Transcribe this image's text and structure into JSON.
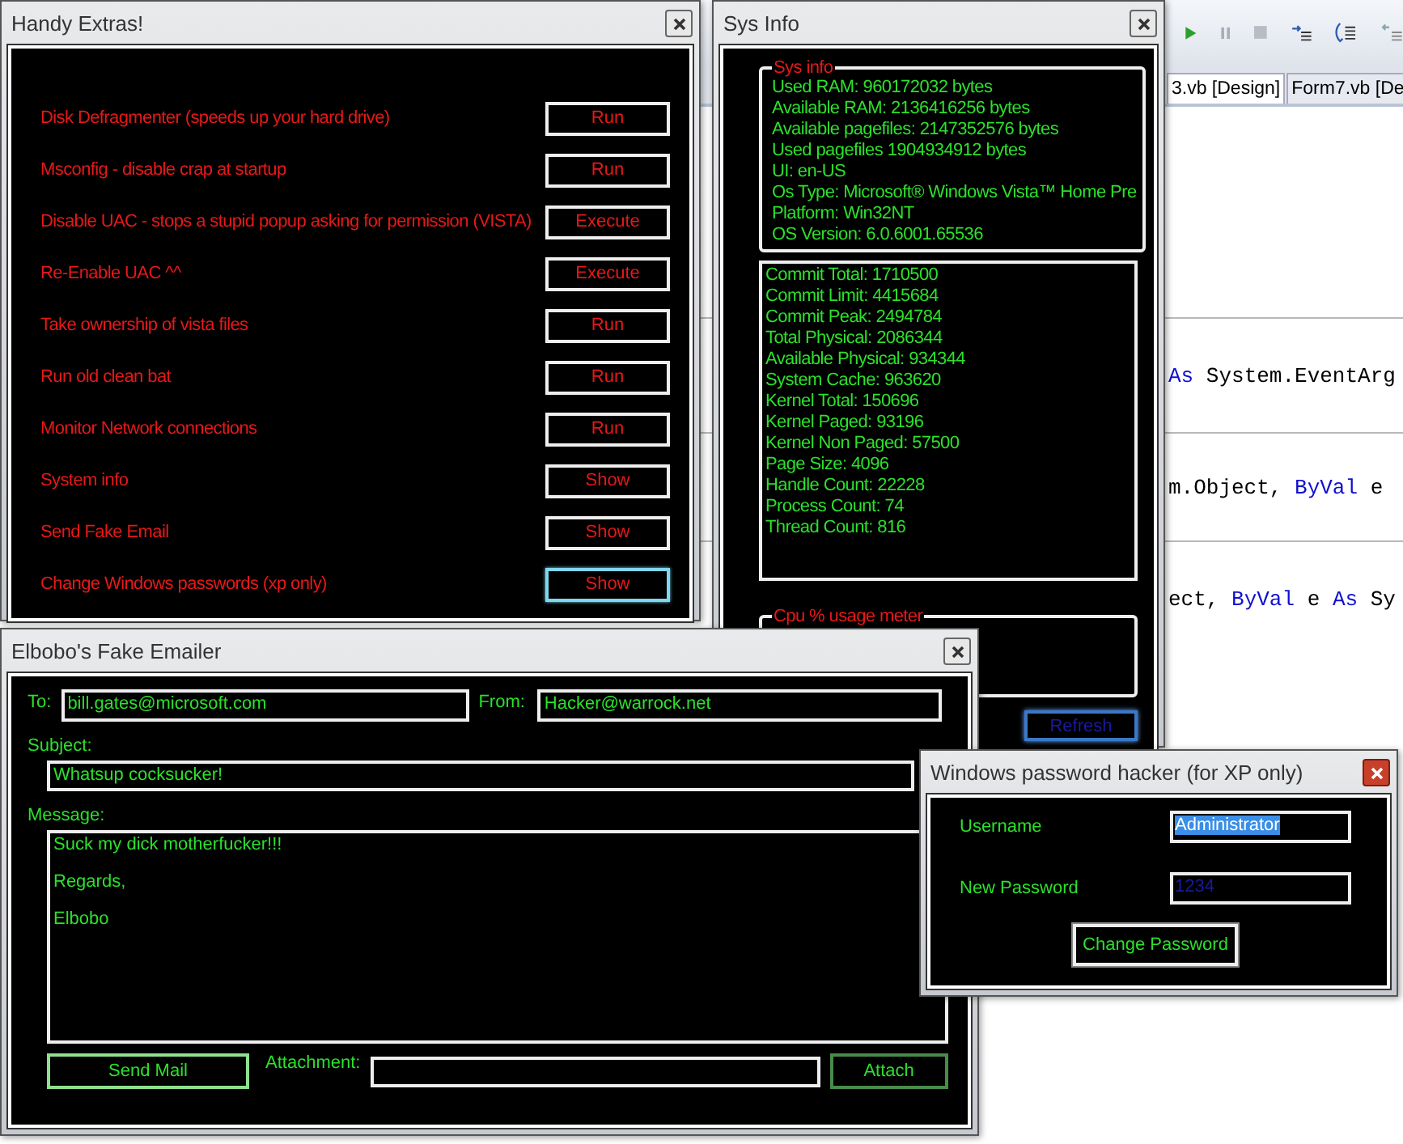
{
  "ide": {
    "tabs": [
      {
        "label": "3.vb [Design]",
        "selected": true
      },
      {
        "label": "Form7.vb [De",
        "selected": false
      }
    ],
    "code_lines": [
      [
        {
          "text": "As",
          "kind": "keyword"
        },
        {
          "text": " System.EventArg",
          "kind": "plain"
        }
      ],
      [
        {
          "text": "m.Object, ",
          "kind": "plain"
        },
        {
          "text": "ByVal",
          "kind": "keyword"
        },
        {
          "text": " e",
          "kind": "plain"
        }
      ],
      [
        {
          "text": "ect, ",
          "kind": "plain"
        },
        {
          "text": "ByVal",
          "kind": "keyword"
        },
        {
          "text": " e ",
          "kind": "plain"
        },
        {
          "text": "As",
          "kind": "keyword"
        },
        {
          "text": " Sy",
          "kind": "plain"
        }
      ]
    ]
  },
  "handy_extras": {
    "title": "Handy Extras!",
    "active": false,
    "items": [
      {
        "label": "Disk Defragmenter (speeds up your hard drive)",
        "button": "Run",
        "focused": false
      },
      {
        "label": "Msconfig - disable crap at startup",
        "button": "Run",
        "focused": false
      },
      {
        "label": "Disable UAC - stops a stupid popup asking for permission (VISTA)",
        "button": "Execute",
        "focused": false
      },
      {
        "label": "Re-Enable UAC ^^",
        "button": "Execute",
        "focused": false
      },
      {
        "label": "Take ownership of vista files",
        "button": "Run",
        "focused": false
      },
      {
        "label": "Run old clean bat",
        "button": "Run",
        "focused": false
      },
      {
        "label": "Monitor Network connections",
        "button": "Run",
        "focused": false
      },
      {
        "label": "System info",
        "button": "Show",
        "focused": false
      },
      {
        "label": "Send Fake Email",
        "button": "Show",
        "focused": false
      },
      {
        "label": "Change Windows passwords (xp only)",
        "button": "Show",
        "focused": true
      }
    ]
  },
  "sys_info": {
    "title": "Sys Info",
    "active": false,
    "group_title": "Sys info",
    "info_lines": [
      "Used RAM: 960172032 bytes",
      "Available RAM: 2136416256 bytes",
      "Available pagefiles: 2147352576 bytes",
      "Used pagefiles 1904934912 bytes",
      "UI: en-US",
      "Os Type: Microsoft® Windows Vista™ Home Pre",
      "Platform: Win32NT",
      "OS Version: 6.0.6001.65536"
    ],
    "perf_lines": [
      "Commit Total: 1710500",
      "Commit Limit: 4415684",
      "Commit Peak: 2494784",
      "Total Physical: 2086344",
      "Available Physical: 934344",
      "System Cache: 963620",
      "Kernel Total: 150696",
      "Kernel Paged: 93196",
      "Kernel Non Paged: 57500",
      "Page Size: 4096",
      "Handle Count: 22228",
      "Process Count: 74",
      "Thread Count: 816"
    ],
    "cpu_title": "Cpu % usage meter",
    "refresh_button": {
      "label": "Refresh",
      "focused": true
    }
  },
  "emailer": {
    "title": "Elbobo's Fake Emailer",
    "active": false,
    "to_label": "To:",
    "to": "bill.gates@microsoft.com",
    "from_label": "From:",
    "from": "Hacker@warrock.net",
    "subject_label": "Subject:",
    "subject": "Whatsup cocksucker!",
    "message_label": "Message:",
    "message_lines": [
      "Suck my dick motherfucker!!!",
      "Regards,",
      "Elbobo"
    ],
    "send_button": "Send Mail",
    "attachment_label": "Attachment:",
    "attach_button": "Attach"
  },
  "password_hacker": {
    "title": "Windows password hacker (for XP only)",
    "active": true,
    "username_label": "Username",
    "username": {
      "value": "Administrator",
      "highlighted": true
    },
    "password_label": "New Password",
    "password": {
      "value": "1234",
      "highlighted": false
    },
    "change_button": "Change Password"
  }
}
